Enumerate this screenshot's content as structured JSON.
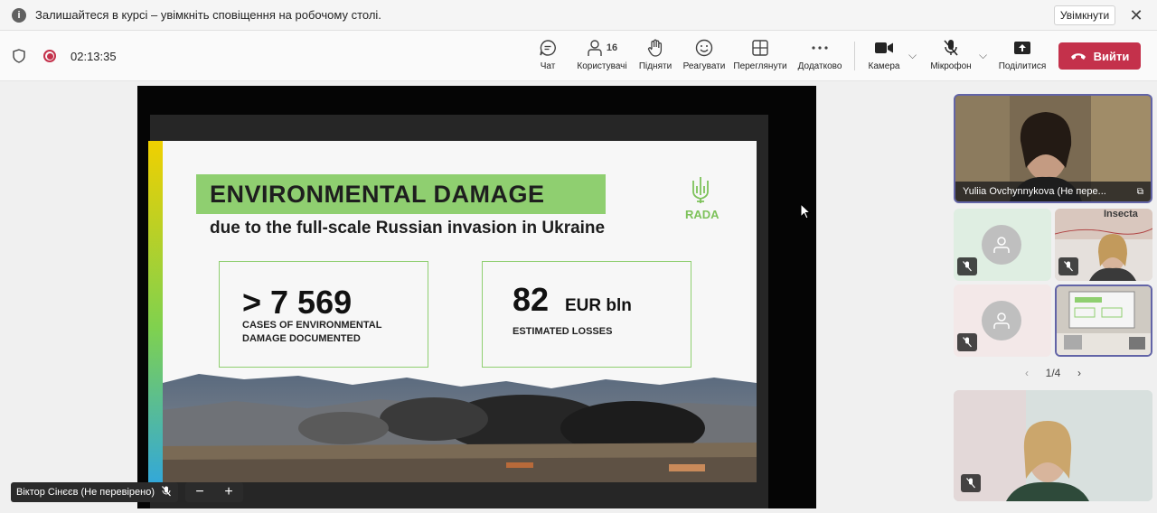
{
  "notification": {
    "message": "Залишайтеся в курсі – увімкніть сповіщення на робочому столі.",
    "enable_label": "Увімкнути",
    "info_icon": "i",
    "close_icon": "✕"
  },
  "toolbar": {
    "timer": "02:13:35",
    "chat_label": "Чат",
    "people_count": "16",
    "people_label": "Користувачі",
    "raise_label": "Підняти",
    "react_label": "Реагувати",
    "view_label": "Переглянути",
    "more_label": "Додатково",
    "camera_label": "Камера",
    "mic_label": "Мікрофон",
    "share_label": "Поділитися",
    "leave_label": "Вийти"
  },
  "slide": {
    "title": "ENVIRONMENTAL DAMAGE",
    "subtitle": "due to the full-scale Russian invasion in Ukraine",
    "logo_text": "RADA",
    "stat1_value": "> 7 569",
    "stat1_caption_line1": "CASES OF ENVIRONMENTAL",
    "stat1_caption_line2": "DAMAGE DOCUMENTED",
    "stat2_value": "82",
    "stat2_unit": "EUR bln",
    "stat2_caption": "ESTIMATED LOSSES"
  },
  "stage": {
    "speaker_name": "Віктор Сінєєв (Не перевірено)",
    "zoom_out": "−",
    "zoom_in": "+"
  },
  "participants": {
    "main_name": "Yuliia Ovchynnykova (Не пере...",
    "tile_sign_text": "Insecta",
    "pager": "1/4"
  },
  "colors": {
    "accent": "#6264a7",
    "leave": "#c4314b",
    "slide_green": "#8fcf70"
  }
}
